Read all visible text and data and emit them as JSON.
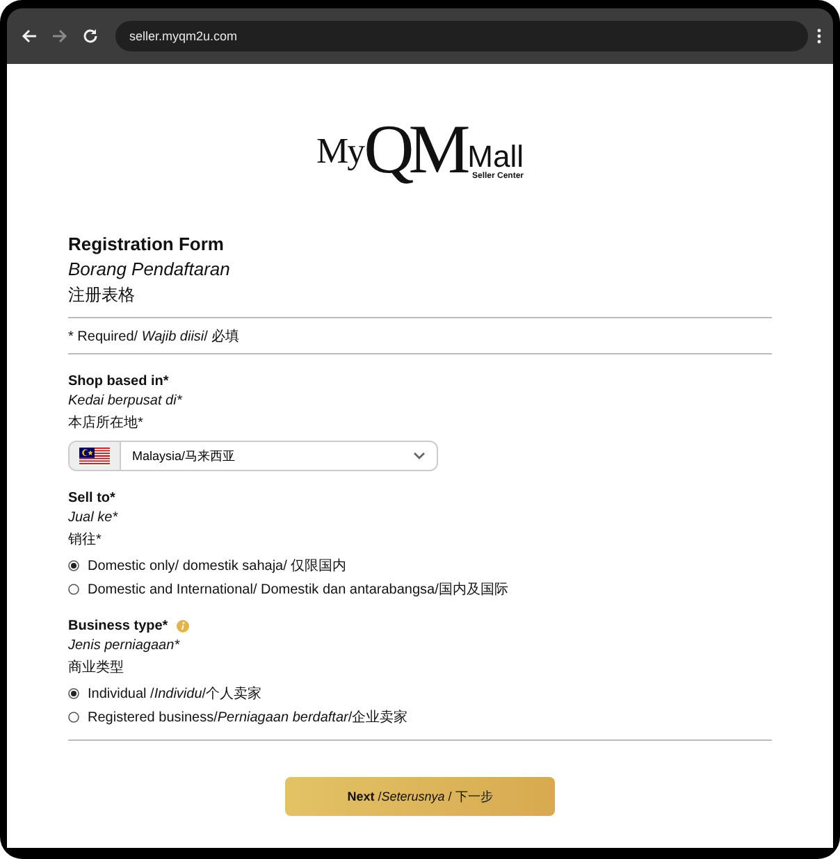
{
  "browser": {
    "nav": [
      {
        "kind": "back",
        "disabled": false
      },
      {
        "kind": "forward",
        "disabled": true
      },
      {
        "kind": "reload",
        "disabled": false
      }
    ],
    "url": "seller.myqm2u.com"
  },
  "logo": {
    "prefix": "My",
    "mark": "QM",
    "suffix": "Mall",
    "tagline": "Seller Center"
  },
  "form": {
    "title": "Registration Form",
    "title_ms": "Borang Pendaftaran",
    "title_zh": "注册表格",
    "required_note": "* Required/ *Wajib diisi*/ 必填",
    "sections": [
      {
        "kind": "select",
        "label": "Shop based in*",
        "label_ms": "Kedai berpusat di*",
        "label_zh": "本店所在地*",
        "info": false,
        "value": "Malaysia/马来西亚"
      },
      {
        "kind": "radio",
        "label": "Sell to*",
        "label_ms": "Jual ke*",
        "label_zh": "销往*",
        "info": false,
        "options": [
          {
            "text": "Domestic only/ domestik sahaja/ 仅限国内",
            "selected": true
          },
          {
            "text": "Domestic and International/  Domestik dan antarabangsa/国内及国际",
            "selected": false
          }
        ]
      },
      {
        "kind": "radio",
        "label": "Business type*",
        "label_ms": "Jenis perniagaan*",
        "label_zh": "商业类型",
        "info": true,
        "options": [
          {
            "text": "Individual /*Individu*/个人卖家",
            "selected": true
          },
          {
            "text": "Registered business/*Perniagaan berdaftar*/企业卖家",
            "selected": false
          }
        ]
      }
    ],
    "next_button": "**Next** /*Seterusnya* / 下一步"
  }
}
